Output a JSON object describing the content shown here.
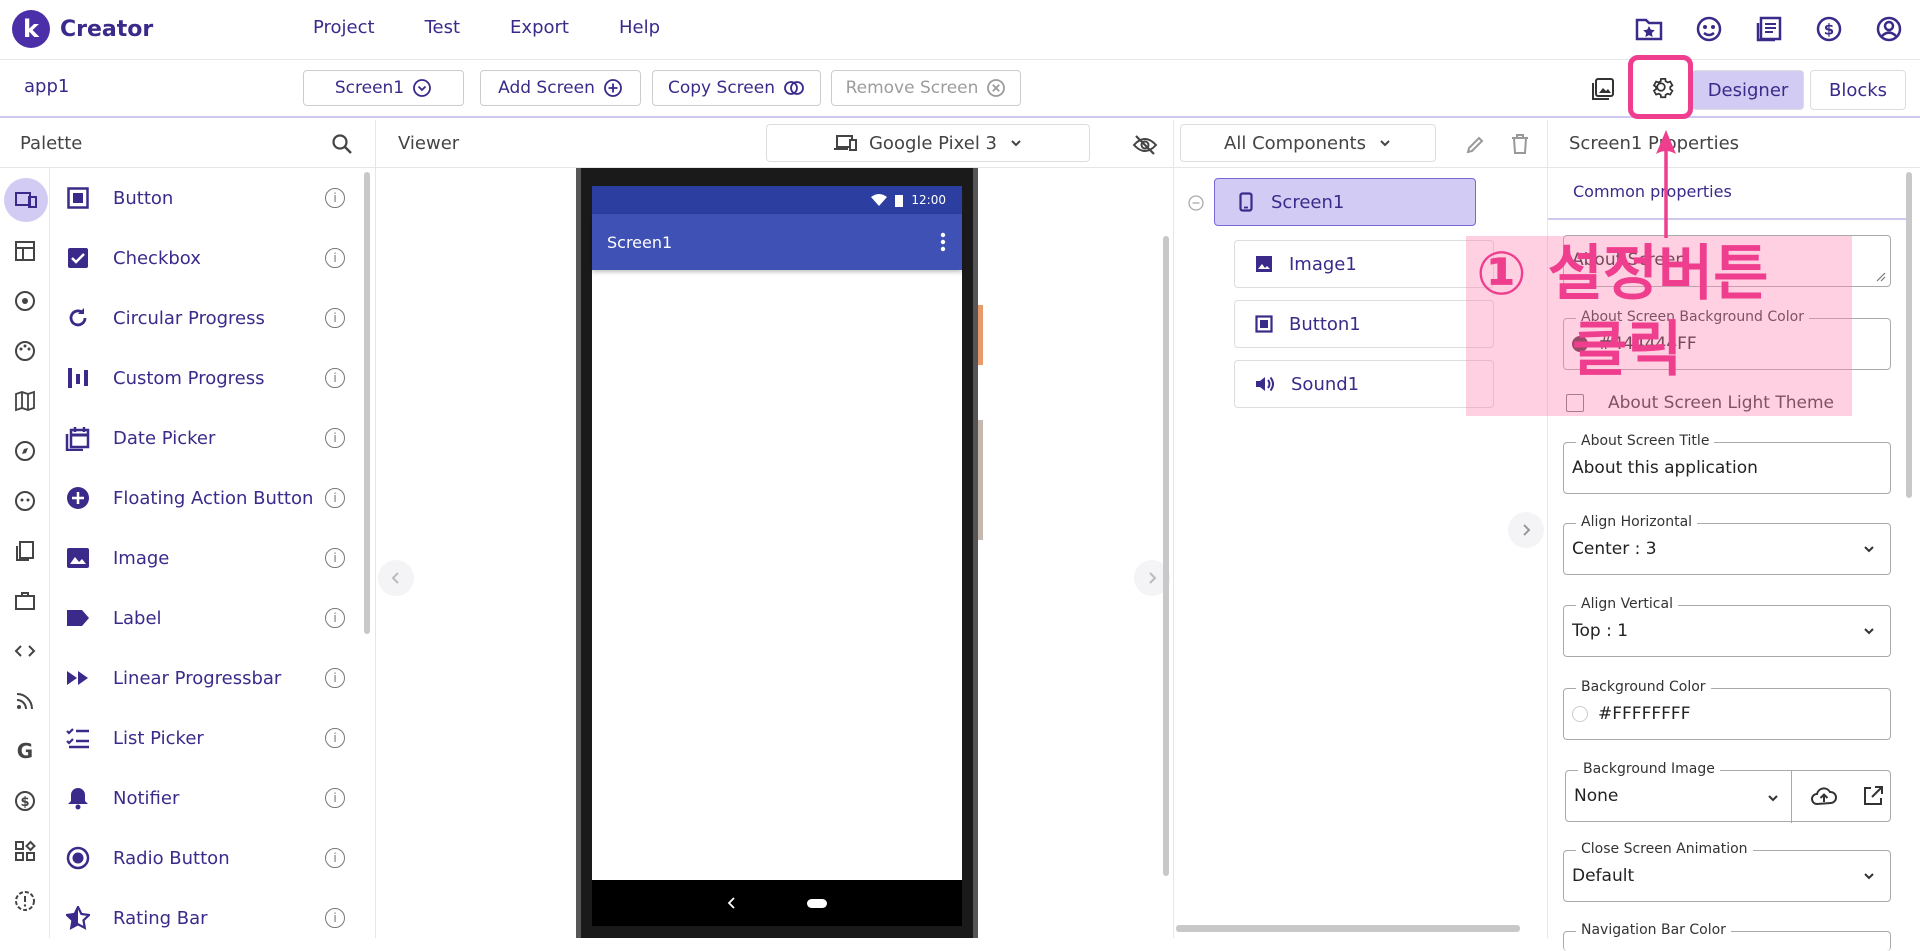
{
  "header": {
    "logo_letter": "k",
    "logo_text": "Creator",
    "menu": [
      "Project",
      "Test",
      "Export",
      "Help"
    ],
    "icons": [
      "folder-star-icon",
      "palette-face-icon",
      "news-icon",
      "dollar-icon",
      "account-icon"
    ]
  },
  "toolbar": {
    "app_name": "app1",
    "screen_select": "Screen1",
    "add_screen": "Add Screen",
    "copy_screen": "Copy Screen",
    "remove_screen": "Remove Screen",
    "designer": "Designer",
    "blocks": "Blocks"
  },
  "palette": {
    "title": "Palette",
    "items": [
      "Button",
      "Checkbox",
      "Circular Progress",
      "Custom Progress",
      "Date Picker",
      "Floating Action Button",
      "Image",
      "Label",
      "Linear Progressbar",
      "List Picker",
      "Notifier",
      "Radio Button",
      "Rating Bar"
    ]
  },
  "viewer": {
    "title": "Viewer",
    "device": "Google Pixel 3",
    "status_time": "12:00",
    "screen_title": "Screen1"
  },
  "components": {
    "filter": "All Components",
    "tree": [
      "Screen1",
      "Image1",
      "Button1",
      "Sound1"
    ]
  },
  "properties": {
    "title": "Screen1 Properties",
    "tab": "Common properties",
    "about_screen_label": "About Screen",
    "about_bg_label": "About Screen Background Color",
    "about_bg_value": "#444444FF",
    "light_theme_label": "About Screen Light Theme",
    "about_title_label": "About Screen Title",
    "about_title_value": "About this application",
    "align_h_label": "Align Horizontal",
    "align_h_value": "Center : 3",
    "align_v_label": "Align Vertical",
    "align_v_value": "Top : 1",
    "bg_color_label": "Background Color",
    "bg_color_value": "#FFFFFFFF",
    "bg_image_label": "Background Image",
    "bg_image_value": "None",
    "close_anim_label": "Close Screen Animation",
    "close_anim_value": "Default",
    "nav_bar_label": "Navigation Bar Color"
  },
  "annotation": {
    "line1": "① 설정버튼",
    "line2": "클릭"
  },
  "colors": {
    "brand": "#4b2fa8",
    "accent": "#ef3e8e",
    "selected": "#d2cbf3",
    "appbar": "#3f51b5"
  }
}
